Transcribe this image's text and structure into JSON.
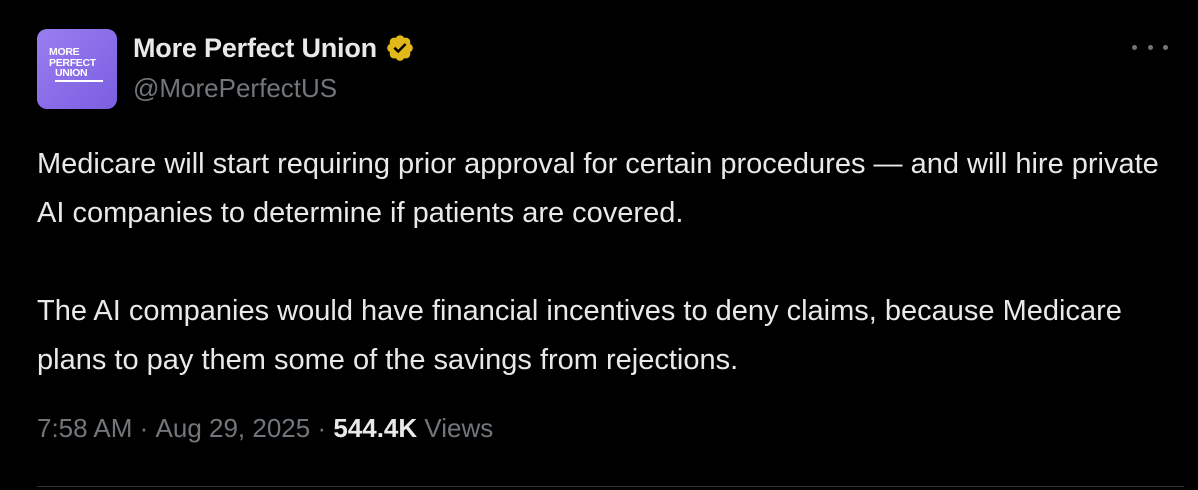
{
  "author": {
    "display_name": "More Perfect Union",
    "handle": "@MorePerfectUS",
    "verified_badge_icon": "verified-gold-badge-icon",
    "verified_color": "#e2b719",
    "avatar": {
      "logo_lines": [
        "MORE",
        "PERFECT",
        "UNION"
      ],
      "background": "#8a6ee8"
    }
  },
  "more_menu_icon": "more-horizontal-icon",
  "body": {
    "paragraphs": [
      "Medicare will start requiring prior approval for certain procedures — and will hire private AI companies to determine if patients are covered.",
      "The AI companies would have financial incentives to deny claims, because Medicare plans to pay them some of the savings from rejections."
    ]
  },
  "meta": {
    "time": "7:58 AM",
    "separator": " · ",
    "date": "Aug 29, 2025",
    "views_count": "544.4K",
    "views_label": "Views"
  },
  "colors": {
    "background": "#000000",
    "primary_text": "#e7e9ea",
    "secondary_text": "#71767b",
    "divider": "#2f3336"
  }
}
